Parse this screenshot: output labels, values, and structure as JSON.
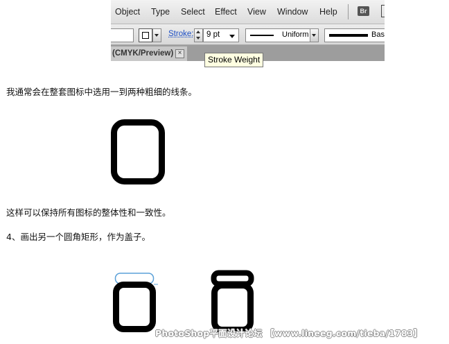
{
  "menubar": {
    "items": [
      "Object",
      "Type",
      "Select",
      "Effect",
      "View",
      "Window",
      "Help"
    ],
    "bridge_label": "Br"
  },
  "controlbar": {
    "stroke_label": "Stroke:",
    "stroke_weight": "9 pt",
    "profile_label": "Uniform",
    "brush_label": "Basic"
  },
  "document_tab": {
    "label": "(CMYK/Preview)",
    "close_glyph": "×"
  },
  "tooltip": "Stroke Weight",
  "article": {
    "para1": "我通常会在整套图标中选用一到两种粗细的线条。",
    "para2": "这样可以保持所有图标的整体性和一致性。",
    "para3": "4、画出另一个圆角矩形，作为盖子。"
  },
  "watermark": "PhotoShop平面设计论坛 【www.lineeg.com/tieba/1783】",
  "colors": {
    "selection_outline": "#5aa0d8",
    "link_blue": "#1d4fc5",
    "tooltip_bg": "#ffffe1"
  }
}
